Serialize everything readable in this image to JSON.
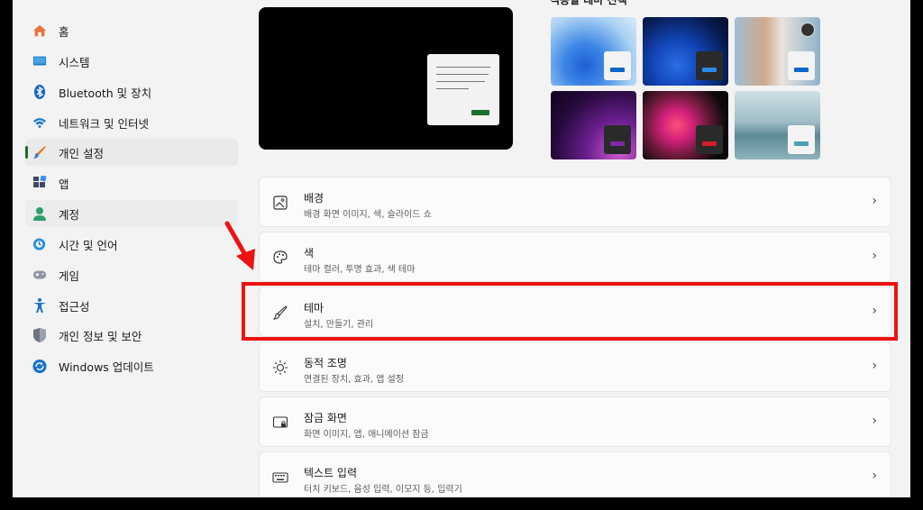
{
  "sidebar": {
    "items": [
      {
        "label": "홈",
        "icon": "home-icon"
      },
      {
        "label": "시스템",
        "icon": "display-icon"
      },
      {
        "label": "Bluetooth 및 장치",
        "icon": "bluetooth-icon"
      },
      {
        "label": "네트워크 및 인터넷",
        "icon": "wifi-icon"
      },
      {
        "label": "개인 설정",
        "icon": "brush-icon",
        "selected": true
      },
      {
        "label": "앱",
        "icon": "apps-icon"
      },
      {
        "label": "계정",
        "icon": "person-icon"
      },
      {
        "label": "시간 및 언어",
        "icon": "globe-clock-icon"
      },
      {
        "label": "게임",
        "icon": "gamepad-icon"
      },
      {
        "label": "접근성",
        "icon": "accessibility-icon"
      },
      {
        "label": "개인 정보 및 보안",
        "icon": "shield-icon"
      },
      {
        "label": "Windows 업데이트",
        "icon": "update-icon"
      }
    ]
  },
  "themes": {
    "title": "적용할 테마 선택"
  },
  "cards": [
    {
      "title": "배경",
      "subtitle": "배경 화면 이미지, 색, 슬라이드 쇼",
      "icon": "picture-icon"
    },
    {
      "title": "색",
      "subtitle": "테마 컬러, 투명 효과, 색 테마",
      "icon": "palette-icon"
    },
    {
      "title": "테마",
      "subtitle": "설치, 만들기, 관리",
      "icon": "brush-icon"
    },
    {
      "title": "동적 조명",
      "subtitle": "연결된 장치, 효과, 앱 설정",
      "icon": "dynamic-lighting-icon"
    },
    {
      "title": "잠금 화면",
      "subtitle": "화면 이미지, 앱, 애니메이션 잠금",
      "icon": "lock-screen-icon"
    },
    {
      "title": "텍스트 입력",
      "subtitle": "터치 키보드, 음성 입력, 이모지 등, 입력기",
      "icon": "keyboard-icon"
    }
  ],
  "colors": {
    "accent": "#1b6e2a",
    "highlight": "#ee1111"
  }
}
